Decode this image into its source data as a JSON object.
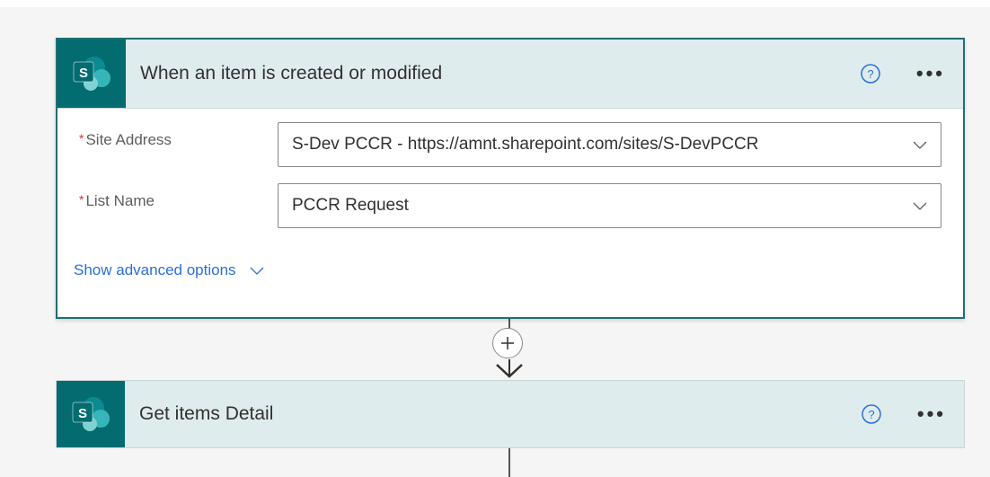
{
  "flow": {
    "steps": [
      {
        "title": "When an item is created or modified",
        "icon": "sharepoint-icon",
        "fields": [
          {
            "label": "Site Address",
            "required_mark": "*",
            "value": "S-Dev PCCR - https://amnt.sharepoint.com/sites/S-DevPCCR"
          },
          {
            "label": "List Name",
            "required_mark": "*",
            "value": "PCCR Request"
          }
        ],
        "advanced_link": "Show advanced options"
      },
      {
        "title": "Get items Detail",
        "icon": "sharepoint-icon"
      }
    ]
  },
  "colors": {
    "sharepoint_teal": "#036c70",
    "header_bg": "#dfeced",
    "link_blue": "#2b6fd6",
    "required_red": "#d13438"
  }
}
